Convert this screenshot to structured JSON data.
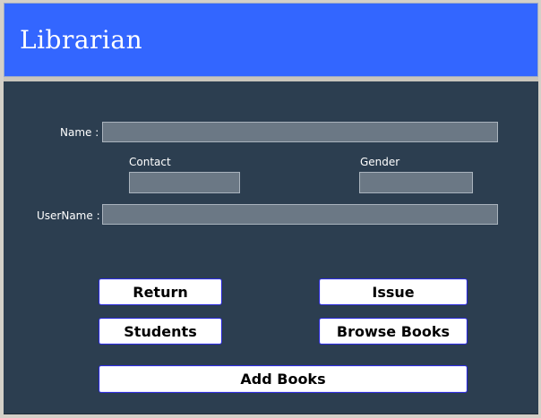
{
  "window": {
    "title": "Librarian"
  },
  "form": {
    "name_label": "Name :",
    "name_value": "",
    "contact_label": "Contact",
    "contact_value": "",
    "gender_label": "Gender",
    "gender_value": "",
    "username_label": "UserName :",
    "username_value": ""
  },
  "buttons": {
    "return_label": "Return",
    "issue_label": "Issue",
    "students_label": "Students",
    "browse_books_label": "Browse Books",
    "add_books_label": "Add Books"
  },
  "colors": {
    "header": "#3366ff",
    "panel": "#2c3e50",
    "field": "#6b7885",
    "button_border": "#2a2ad8"
  }
}
